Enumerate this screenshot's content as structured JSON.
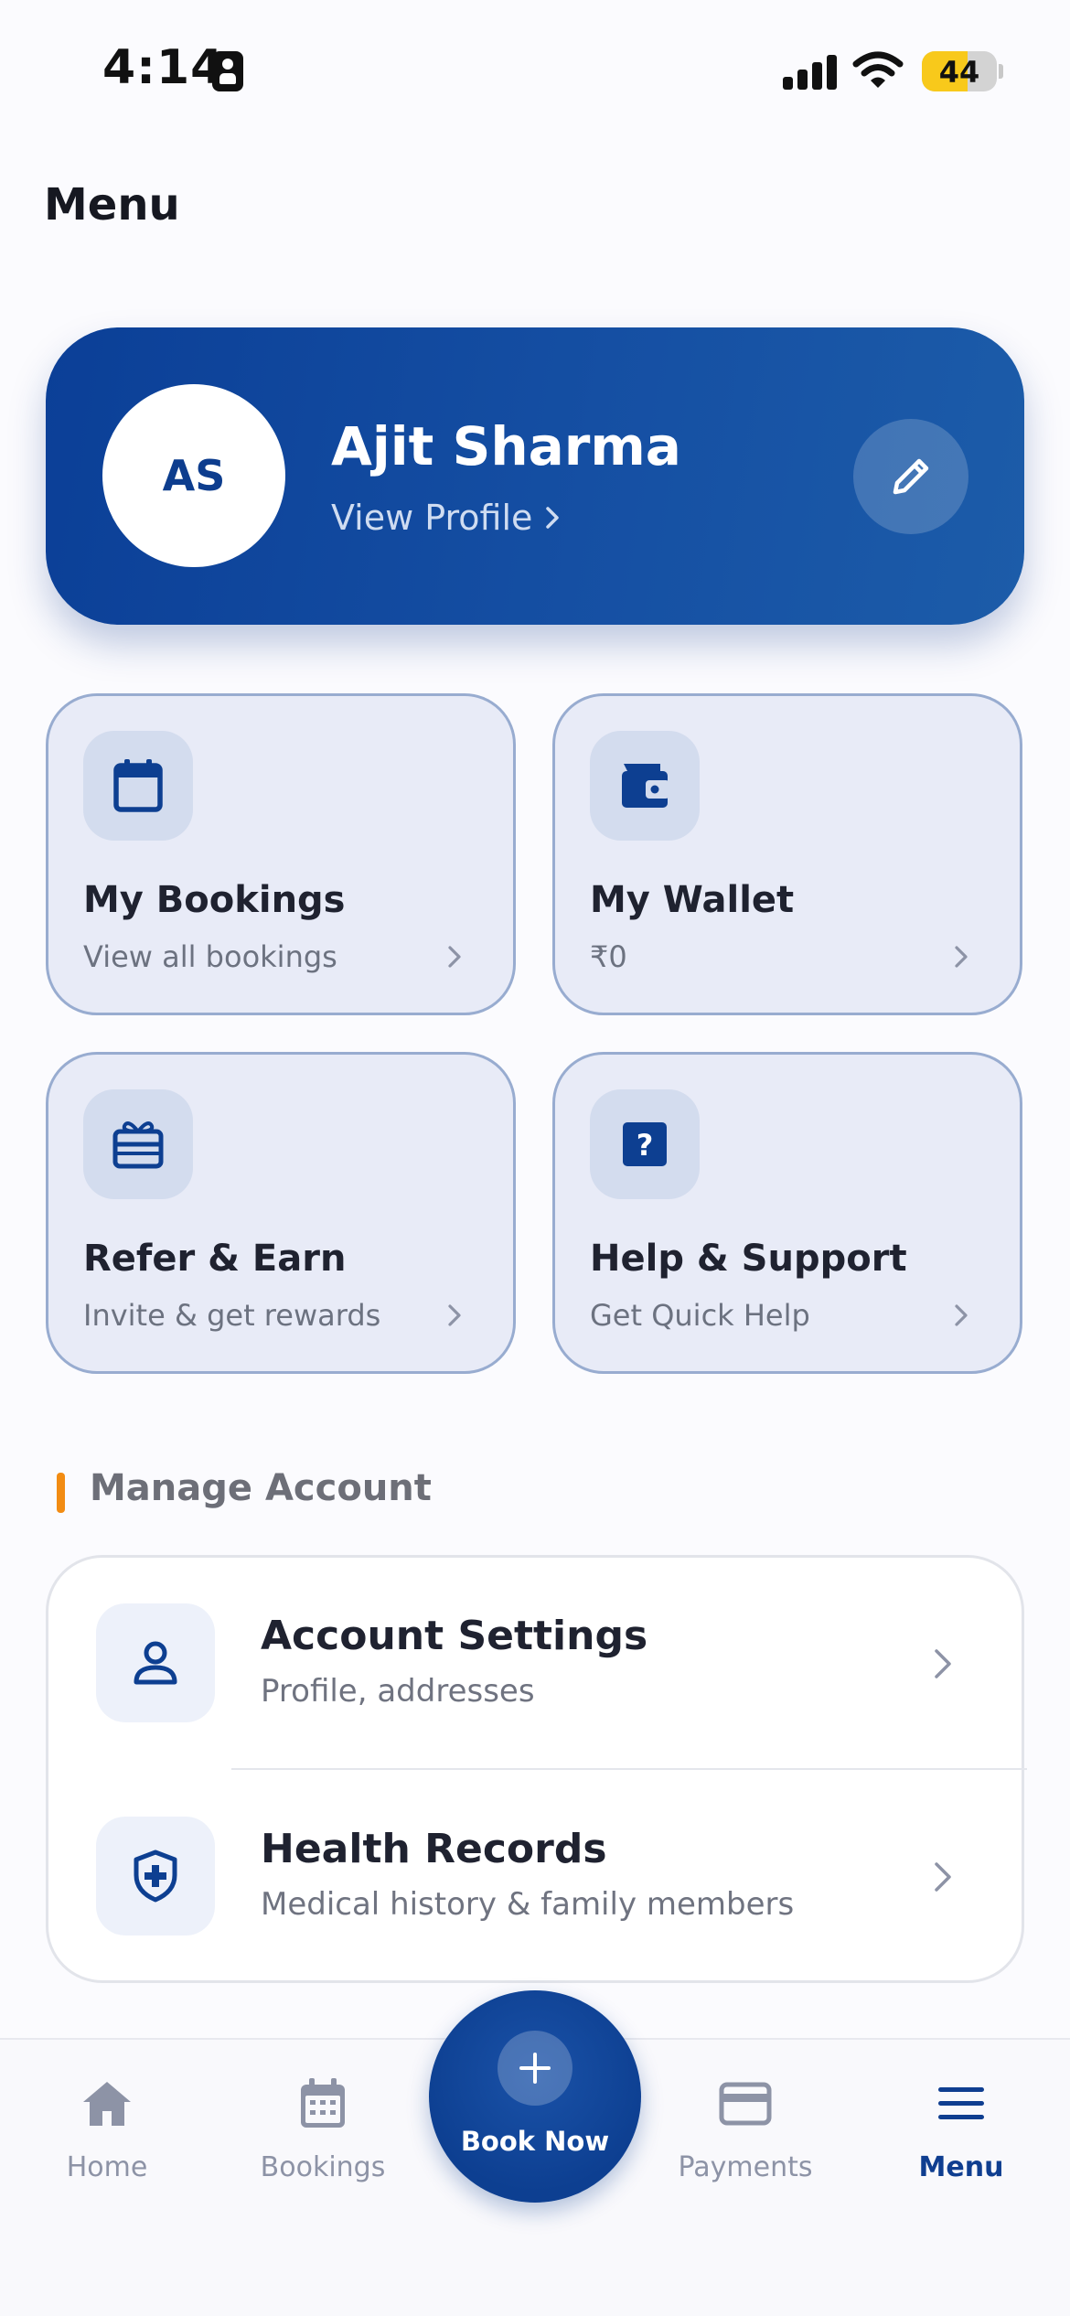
{
  "status_bar": {
    "time": "4:14",
    "battery": "44"
  },
  "page": {
    "title": "Menu"
  },
  "profile": {
    "initials": "AS",
    "name": "Ajit Sharma",
    "link_label": "View Profile"
  },
  "tiles": [
    {
      "title": "My Bookings",
      "subtitle": "View all bookings",
      "icon": "calendar-icon"
    },
    {
      "title": "My Wallet",
      "subtitle": "₹0",
      "icon": "wallet-icon"
    },
    {
      "title": "Refer & Earn",
      "subtitle": "Invite & get rewards",
      "icon": "gift-card-icon"
    },
    {
      "title": "Help & Support",
      "subtitle": "Get Quick Help",
      "icon": "help-icon"
    }
  ],
  "manage_account": {
    "title": "Manage Account",
    "items": [
      {
        "title": "Account Settings",
        "subtitle": "Profile, addresses",
        "icon": "user-icon"
      },
      {
        "title": "Health Records",
        "subtitle": "Medical history & family members",
        "icon": "shield-plus-icon"
      }
    ]
  },
  "bottom_nav": {
    "items": [
      {
        "label": "Home",
        "icon": "home-icon",
        "active": false
      },
      {
        "label": "Bookings",
        "icon": "calendar-icon",
        "active": false
      },
      {
        "label": "Payments",
        "icon": "credit-card-icon",
        "active": false
      },
      {
        "label": "Menu",
        "icon": "menu-icon",
        "active": true
      }
    ],
    "book_now_label": "Book Now"
  },
  "colors": {
    "primary": "#0d3f91",
    "accent": "#f28c13",
    "tile_bg": "#e8ebf7",
    "tile_border": "#98acd0",
    "inactive_nav": "#8d93a6"
  }
}
